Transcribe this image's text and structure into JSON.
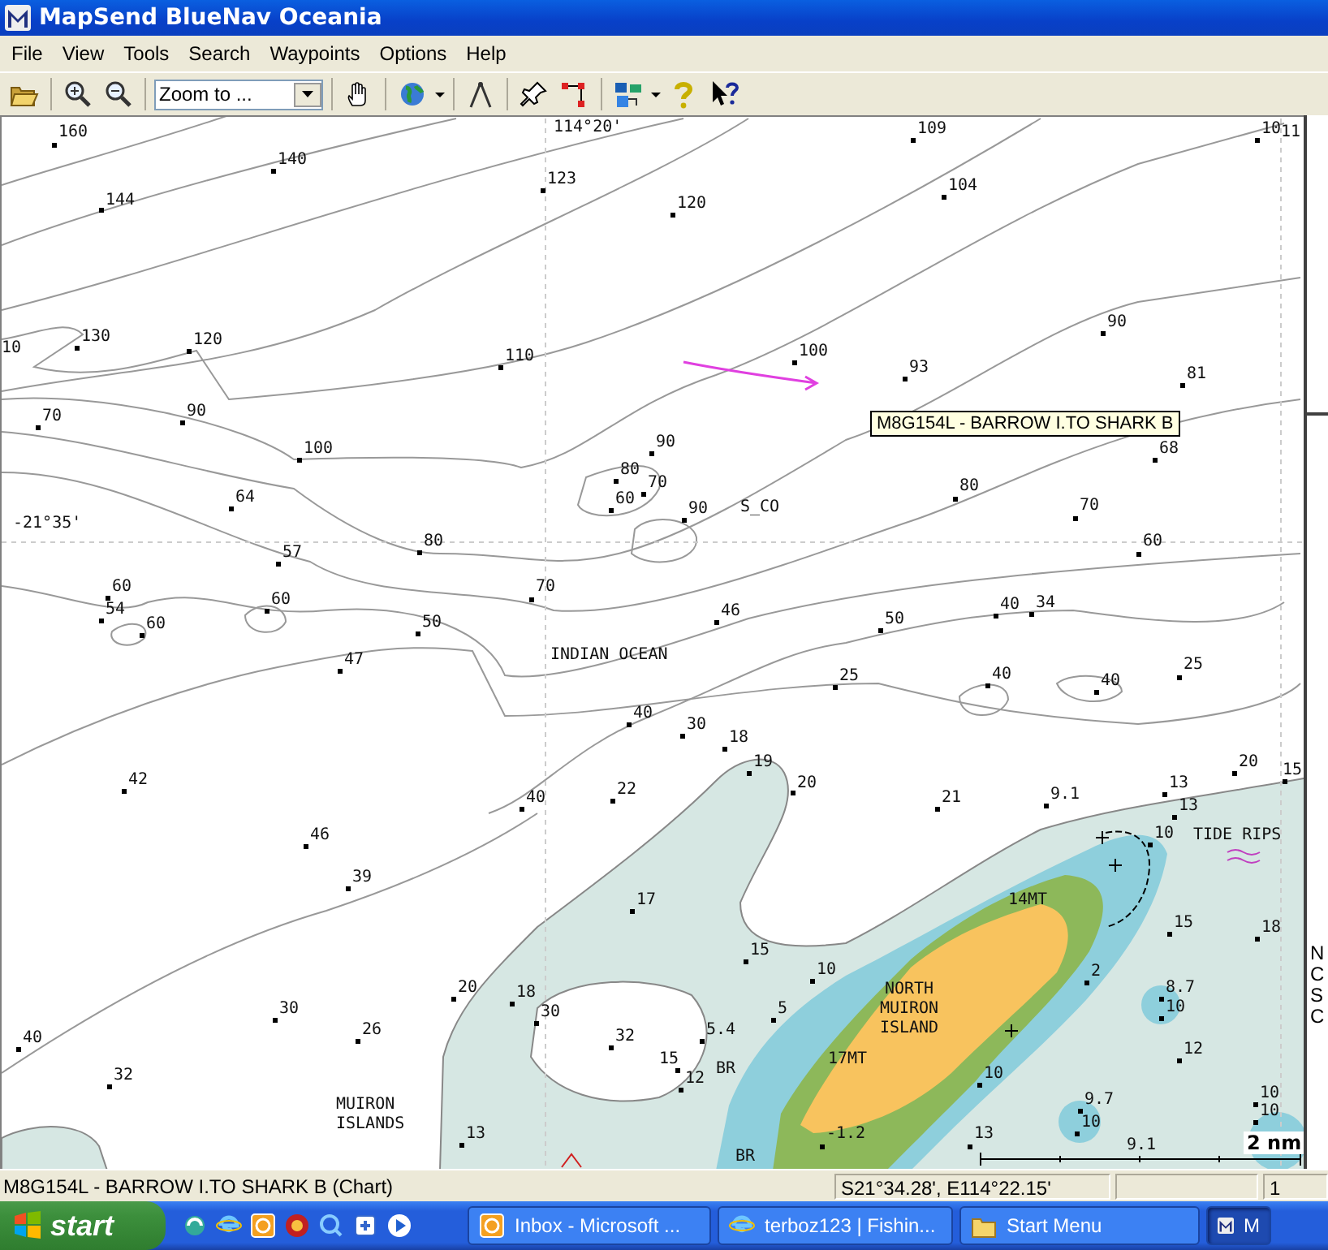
{
  "window": {
    "title": "MapSend BlueNav Oceania"
  },
  "menu": [
    "File",
    "View",
    "Tools",
    "Search",
    "Waypoints",
    "Options",
    "Help"
  ],
  "toolbar": {
    "zoom_combo": {
      "value": "Zoom to ..."
    }
  },
  "chart": {
    "grid_labels": [
      "114°20'",
      "-21°35'"
    ],
    "soundings": [
      "160",
      "140",
      "144",
      "123",
      "120",
      "109",
      "104",
      "10",
      "11",
      "10",
      "130",
      "120",
      "110",
      "100",
      "93",
      "90",
      "81",
      "70",
      "90",
      "100",
      "90",
      "80",
      "70",
      "60",
      "90",
      "68",
      "80",
      "70",
      "60",
      "64",
      "57",
      "80",
      "70",
      "60",
      "54",
      "60",
      "60",
      "50",
      "47",
      "46",
      "50",
      "40",
      "34",
      "25",
      "40",
      "40",
      "25",
      "40",
      "30",
      "18",
      "19",
      "42",
      "20",
      "40",
      "22",
      "21",
      "9.1",
      "13",
      "20",
      "15",
      "13",
      "10",
      "46",
      "39",
      "17",
      "15",
      "18",
      "15",
      "10",
      "2",
      "8.7",
      "10",
      "20",
      "18",
      "30",
      "30",
      "5",
      "40",
      "26",
      "32",
      "5.4",
      "12",
      "32",
      "15",
      "12",
      "10",
      "9.7",
      "10",
      "10",
      "10",
      "13",
      "-1.2",
      "13",
      "9.1"
    ],
    "place_names": [
      "INDIAN OCEAN",
      "S_CO",
      "TIDE RIPS",
      "14MT",
      "NORTH MUIRON ISLAND",
      "17MT",
      "BR",
      "MUIRON ISLANDS",
      "BR"
    ],
    "tooltip": "M8G154L - BARROW I.TO SHARK B",
    "scale": "2 nm",
    "side_panel": [
      "N",
      "C",
      "S",
      "C"
    ]
  },
  "status_bar": {
    "chart_name": "M8G154L - BARROW I.TO SHARK B (Chart)",
    "position": "S21°34.28', E114°22.15'",
    "page": "1"
  },
  "taskbar": {
    "start": "start",
    "tasks": [
      {
        "label": "Inbox - Microsoft ...",
        "kind": "mail",
        "selected": false
      },
      {
        "label": "terboz123 | Fishin...",
        "kind": "browser",
        "selected": false
      },
      {
        "label": "Start Menu",
        "kind": "folder",
        "selected": false
      },
      {
        "label": "M",
        "kind": "app",
        "selected": true
      }
    ]
  }
}
